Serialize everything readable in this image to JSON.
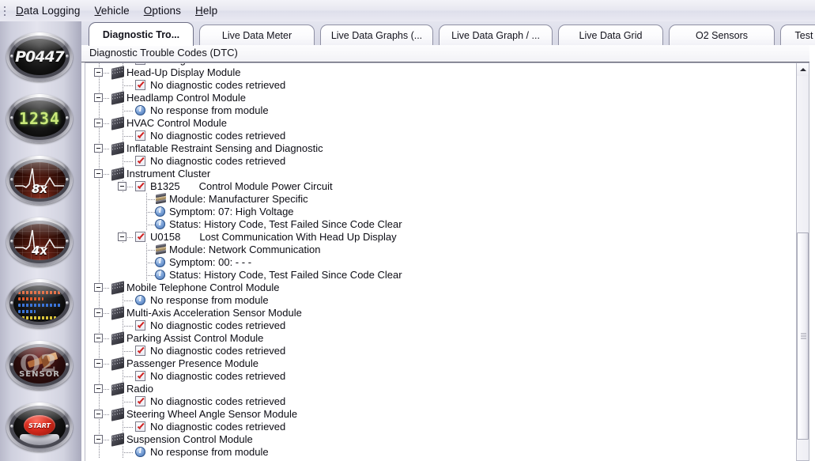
{
  "menu": {
    "grip": "drag-grip",
    "items": [
      {
        "label": "Data Logging",
        "accel": "D"
      },
      {
        "label": "Vehicle",
        "accel": "V"
      },
      {
        "label": "Options",
        "accel": "O"
      },
      {
        "label": "Help",
        "accel": "H"
      }
    ]
  },
  "sidebar": {
    "buttons": [
      {
        "name": "dtc-button",
        "label": "P0447",
        "type": "dtc"
      },
      {
        "name": "live-data-meter-button",
        "label": "1234",
        "type": "digits"
      },
      {
        "name": "live-data-graphs-8x-button",
        "label": "8x",
        "type": "ecg"
      },
      {
        "name": "live-data-graph-4x-button",
        "label": "4x",
        "type": "ecg"
      },
      {
        "name": "live-data-grid-button",
        "label": "",
        "type": "grid"
      },
      {
        "name": "o2-sensors-button",
        "label": "SENSOR",
        "sub": "O2",
        "type": "o2"
      },
      {
        "name": "tests-button",
        "label": "START",
        "type": "start"
      }
    ]
  },
  "tabs": [
    {
      "label": "Diagnostic Tro...",
      "active": true
    },
    {
      "label": "Live Data Meter",
      "active": false
    },
    {
      "label": "Live Data Graphs (...",
      "active": false
    },
    {
      "label": "Live Data Graph / ...",
      "active": false
    },
    {
      "label": "Live Data Grid",
      "active": false
    },
    {
      "label": "O2 Sensors",
      "active": false
    },
    {
      "label": "Test",
      "active": false
    }
  ],
  "panel": {
    "title": "Diagnostic Trouble Codes (DTC)"
  },
  "scrollbar": {
    "up_arrow": "scroll-up-arrow",
    "thumb": "scroll-thumb"
  },
  "tree": [
    {
      "level": 2,
      "icon": "check",
      "text": "No diagnostic codes retrieved",
      "expander": false
    },
    {
      "level": 1,
      "icon": "chip",
      "text": "Head-Up Display Module",
      "expander": true
    },
    {
      "level": 2,
      "icon": "check",
      "text": "No diagnostic codes retrieved",
      "expander": false
    },
    {
      "level": 1,
      "icon": "chip",
      "text": "Headlamp Control Module",
      "expander": true
    },
    {
      "level": 2,
      "icon": "info",
      "text": "No response from module",
      "expander": false
    },
    {
      "level": 1,
      "icon": "chip",
      "text": "HVAC Control Module",
      "expander": true
    },
    {
      "level": 2,
      "icon": "check",
      "text": "No diagnostic codes retrieved",
      "expander": false
    },
    {
      "level": 1,
      "icon": "chip",
      "text": "Inflatable Restraint Sensing and Diagnostic",
      "expander": true
    },
    {
      "level": 2,
      "icon": "check",
      "text": "No diagnostic codes retrieved",
      "expander": false
    },
    {
      "level": 1,
      "icon": "chip",
      "text": "Instrument Cluster",
      "expander": true
    },
    {
      "level": 2,
      "icon": "check",
      "code": "B1325",
      "text": "Control Module Power Circuit",
      "expander": true
    },
    {
      "level": 3,
      "icon": "stack",
      "text": "Module: Manufacturer Specific",
      "expander": false
    },
    {
      "level": 3,
      "icon": "info",
      "text": "Symptom: 07: High Voltage",
      "expander": false
    },
    {
      "level": 3,
      "icon": "info",
      "text": "Status: History Code, Test Failed Since Code Clear",
      "expander": false
    },
    {
      "level": 2,
      "icon": "check",
      "code": "U0158",
      "text": "Lost Communication With Head Up Display",
      "expander": true
    },
    {
      "level": 3,
      "icon": "stack",
      "text": "Module: Network Communication",
      "expander": false
    },
    {
      "level": 3,
      "icon": "info",
      "text": "Symptom: 00: - - -",
      "expander": false
    },
    {
      "level": 3,
      "icon": "info",
      "text": "Status: History Code, Test Failed Since Code Clear",
      "expander": false
    },
    {
      "level": 1,
      "icon": "chip",
      "text": "Mobile Telephone Control Module",
      "expander": true
    },
    {
      "level": 2,
      "icon": "info",
      "text": "No response from module",
      "expander": false
    },
    {
      "level": 1,
      "icon": "chip",
      "text": "Multi-Axis Acceleration Sensor Module",
      "expander": true
    },
    {
      "level": 2,
      "icon": "check",
      "text": "No diagnostic codes retrieved",
      "expander": false
    },
    {
      "level": 1,
      "icon": "chip",
      "text": "Parking Assist Control Module",
      "expander": true
    },
    {
      "level": 2,
      "icon": "check",
      "text": "No diagnostic codes retrieved",
      "expander": false
    },
    {
      "level": 1,
      "icon": "chip",
      "text": "Passenger Presence Module",
      "expander": true
    },
    {
      "level": 2,
      "icon": "check",
      "text": "No diagnostic codes retrieved",
      "expander": false
    },
    {
      "level": 1,
      "icon": "chip",
      "text": "Radio",
      "expander": true
    },
    {
      "level": 2,
      "icon": "check",
      "text": "No diagnostic codes retrieved",
      "expander": false
    },
    {
      "level": 1,
      "icon": "chip",
      "text": "Steering Wheel Angle Sensor Module",
      "expander": true
    },
    {
      "level": 2,
      "icon": "check",
      "text": "No diagnostic codes retrieved",
      "expander": false
    },
    {
      "level": 1,
      "icon": "chip",
      "text": "Suspension Control Module",
      "expander": true
    },
    {
      "level": 2,
      "icon": "info",
      "text": "No response from module",
      "expander": false
    }
  ]
}
